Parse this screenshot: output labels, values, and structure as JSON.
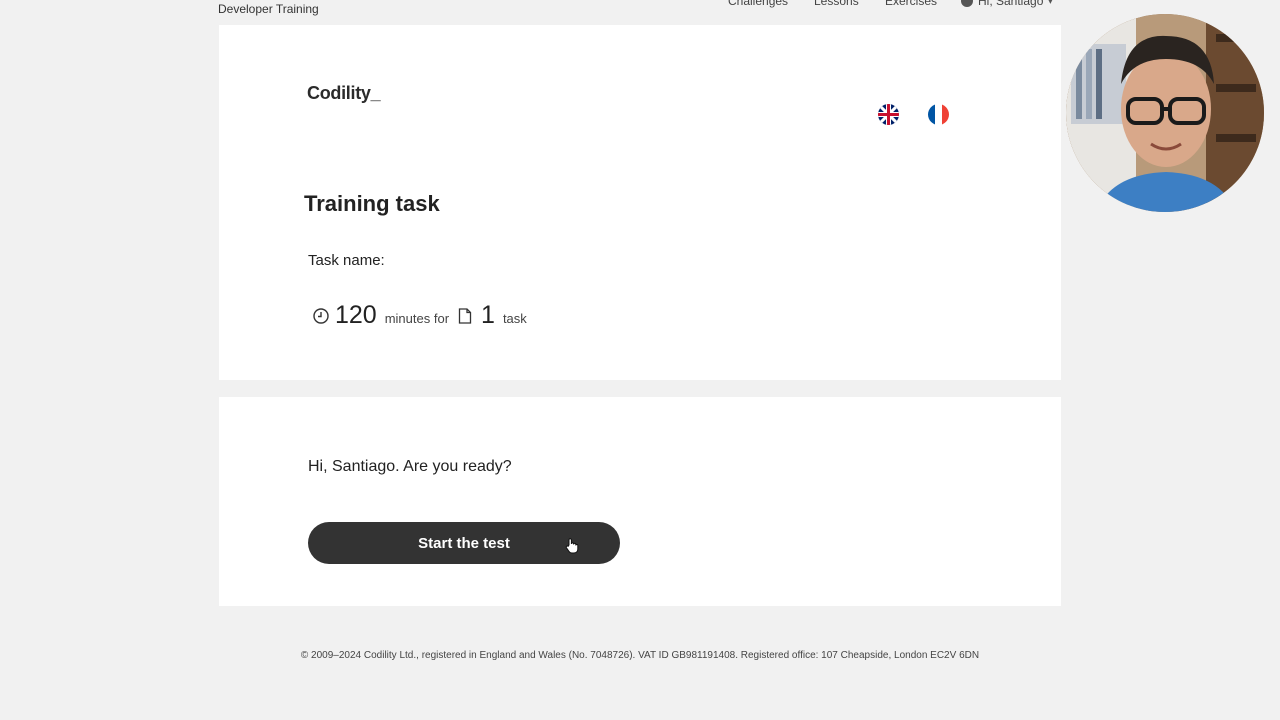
{
  "header": {
    "brand": "Developer Training",
    "nav": [
      "Challenges",
      "Lessons",
      "Exercises"
    ],
    "user_greeting": "Hi, Santiago"
  },
  "card": {
    "logo_text": "Codility_",
    "languages": [
      "uk-flag-icon",
      "france-flag-icon"
    ],
    "title": "Training task",
    "task_name_label": "Task name:",
    "minutes_value": "120",
    "minutes_label": "minutes for",
    "tasks_value": "1",
    "tasks_label": "task"
  },
  "start": {
    "greeting": "Hi, Santiago. Are you ready?",
    "button_label": "Start the test"
  },
  "footer": {
    "text": "© 2009–2024 Codility Ltd., registered in England and Wales (No. 7048726). VAT ID GB981191408. Registered office: 107 Cheapside, London EC2V 6DN"
  },
  "colors": {
    "page_bg": "#f1f1f1",
    "card_bg": "#ffffff",
    "button_bg": "#333333",
    "button_text": "#ffffff",
    "fr_blue": "#0055A4",
    "fr_red": "#EF4135",
    "uk_blue": "#012169",
    "uk_red": "#C8102E"
  }
}
